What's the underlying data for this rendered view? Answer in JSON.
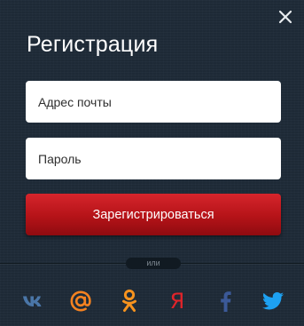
{
  "dialog": {
    "title": "Регистрация",
    "close_icon": "close-icon"
  },
  "form": {
    "email_placeholder": "Адрес почты",
    "password_placeholder": "Пароль",
    "submit_label": "Зарегистрироваться"
  },
  "divider": {
    "label": "или"
  },
  "social": {
    "providers": [
      {
        "name": "vk",
        "icon": "vk-icon",
        "color": "#4a76a8"
      },
      {
        "name": "mail",
        "icon": "at-sign-icon",
        "color": "#f58220"
      },
      {
        "name": "odnoklassniki",
        "icon": "odnoklassniki-icon",
        "color": "#f7931e"
      },
      {
        "name": "yandex",
        "icon": "yandex-icon",
        "glyph": "Я",
        "color": "#e0242a"
      },
      {
        "name": "facebook",
        "icon": "facebook-icon",
        "color": "#3b5998"
      },
      {
        "name": "twitter",
        "icon": "twitter-icon",
        "color": "#1da1f2"
      }
    ]
  },
  "colors": {
    "background": "#1e2b38",
    "accent": "#c1161d",
    "text": "#ffffff"
  }
}
